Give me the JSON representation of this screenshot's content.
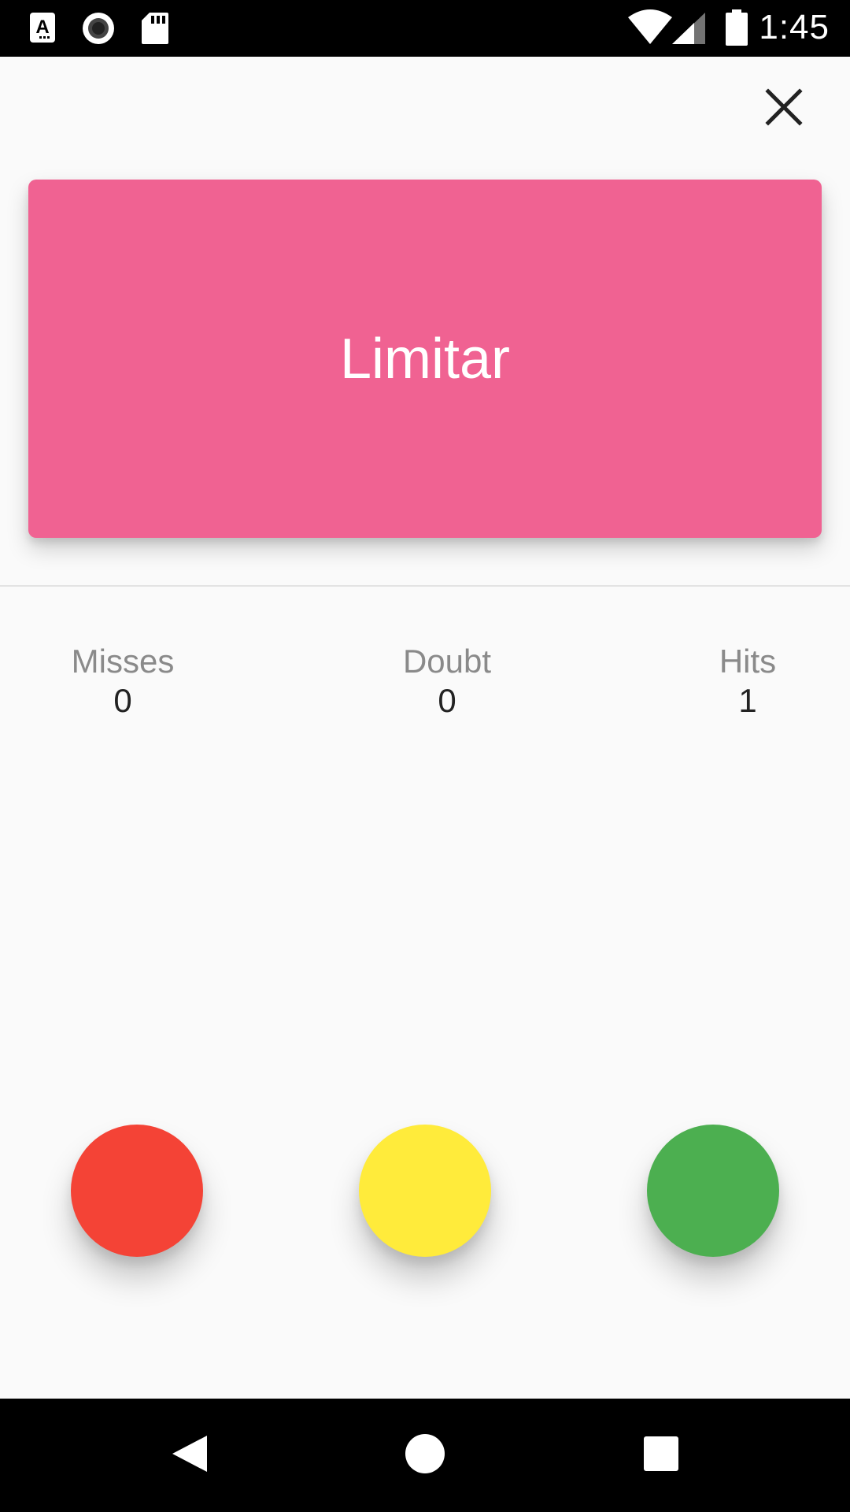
{
  "status_bar": {
    "time": "1:45",
    "left_icons": [
      "a-icon",
      "record-icon",
      "sd-card-icon"
    ],
    "right_icons": [
      "wifi-icon",
      "signal-icon",
      "battery-icon"
    ]
  },
  "header": {
    "close_icon": "close-icon"
  },
  "card": {
    "text": "Limitar",
    "color": "#f06292"
  },
  "stats": {
    "misses": {
      "label": "Misses",
      "value": "0"
    },
    "doubt": {
      "label": "Doubt",
      "value": "0"
    },
    "hits": {
      "label": "Hits",
      "value": "1"
    }
  },
  "buttons": {
    "miss": {
      "color": "#f44336"
    },
    "doubt": {
      "color": "#ffeb3b"
    },
    "hit": {
      "color": "#4caf50"
    }
  },
  "nav_bar": {
    "icons": [
      "back-icon",
      "home-icon",
      "recents-icon"
    ]
  }
}
